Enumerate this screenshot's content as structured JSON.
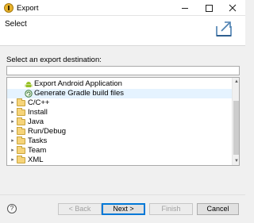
{
  "window": {
    "title": "Export",
    "controls": {
      "minimize_icon": "minimize-icon",
      "maximize_icon": "maximize-icon",
      "close_icon": "close-icon"
    }
  },
  "banner": {
    "title": "Select",
    "icon": "export-wizard-icon"
  },
  "destination": {
    "prompt": "Select an export destination:",
    "filter_value": "",
    "filter_placeholder": ""
  },
  "tree": {
    "items": [
      {
        "label": "Export Android Application",
        "kind": "item",
        "icon": "android-icon",
        "selected": false
      },
      {
        "label": "Generate Gradle build files",
        "kind": "item",
        "icon": "gradle-icon",
        "selected": true
      },
      {
        "label": "C/C++",
        "kind": "folder",
        "icon": "folder-icon",
        "expanded": false
      },
      {
        "label": "Install",
        "kind": "folder",
        "icon": "folder-icon",
        "expanded": false
      },
      {
        "label": "Java",
        "kind": "folder",
        "icon": "folder-icon",
        "expanded": false
      },
      {
        "label": "Run/Debug",
        "kind": "folder",
        "icon": "folder-icon",
        "expanded": false
      },
      {
        "label": "Tasks",
        "kind": "folder",
        "icon": "folder-icon",
        "expanded": false
      },
      {
        "label": "Team",
        "kind": "folder",
        "icon": "folder-icon",
        "expanded": false
      },
      {
        "label": "XML",
        "kind": "folder",
        "icon": "folder-icon",
        "expanded": false
      }
    ]
  },
  "buttons": {
    "help_label": "?",
    "back_label": "< Back",
    "next_label": "Next >",
    "finish_label": "Finish",
    "cancel_label": "Cancel"
  },
  "colors": {
    "selection": "#e5f3ff",
    "default_button_border": "#0078d7",
    "android_green": "#97c024"
  }
}
